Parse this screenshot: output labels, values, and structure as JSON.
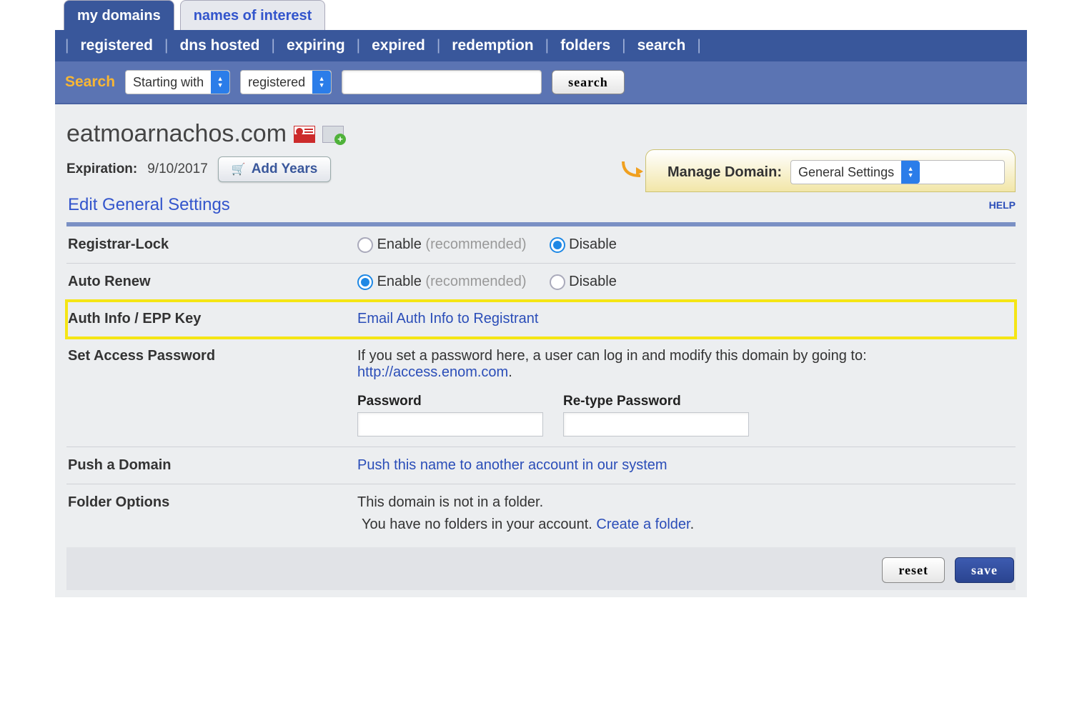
{
  "tabs": {
    "active": "my domains",
    "inactive": "names of interest"
  },
  "nav": {
    "items": [
      "registered",
      "dns hosted",
      "expiring",
      "expired",
      "redemption",
      "folders",
      "search"
    ]
  },
  "search": {
    "label": "Search",
    "mode": "Starting with",
    "scope": "registered",
    "query": "",
    "button": "search"
  },
  "domain": {
    "name": "eatmoarnachos.com",
    "expiration_label": "Expiration:",
    "expiration_date": "9/10/2017",
    "add_years": "Add Years",
    "manage_label": "Manage Domain:",
    "manage_selected": "General Settings"
  },
  "section": {
    "title": "Edit General Settings",
    "help": "HELP"
  },
  "settings": {
    "registrar_lock": {
      "label": "Registrar-Lock",
      "enable": "Enable",
      "rec": "(recommended)",
      "disable": "Disable",
      "selected": "disable"
    },
    "auto_renew": {
      "label": "Auto Renew",
      "enable": "Enable",
      "rec": "(recommended)",
      "disable": "Disable",
      "selected": "enable"
    },
    "auth_info": {
      "label": "Auth Info / EPP Key",
      "link": "Email Auth Info to Registrant"
    },
    "access_pw": {
      "label": "Set Access Password",
      "desc_pre": "If you set a password here, a user can log in and modify this domain by going to: ",
      "link": "http://access.enom.com",
      "desc_post": ".",
      "password_label": "Password",
      "retype_label": "Re-type Password"
    },
    "push": {
      "label": "Push a Domain",
      "link": "Push this name to another account in our system"
    },
    "folder": {
      "label": "Folder Options",
      "line1": "This domain is not in a folder.",
      "line2_pre": "You have no folders in your account. ",
      "link": "Create a folder",
      "line2_post": "."
    }
  },
  "footer": {
    "reset": "reset",
    "save": "save"
  }
}
